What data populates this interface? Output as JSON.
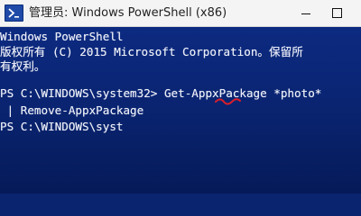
{
  "window": {
    "title": "管理员: Windows PowerShell (x86)"
  },
  "console": {
    "lines": [
      "Windows PowerShell",
      "版权所有 (C) 2015 Microsoft Corporation。保留所",
      "有权利。",
      "PS C:\\WINDOWS\\system32> Get-AppxPackage *photo*",
      " | Remove-AppxPackage",
      "PS C:\\WINDOWS\\syst"
    ]
  },
  "colors": {
    "console_background": "#0a2471",
    "console_text": "#e9ecf6",
    "titlebar_background": "#f4f4f4",
    "annotation": "#d81e2a"
  },
  "icons": {
    "app": "powershell-icon",
    "minimize": "minimize-icon",
    "maximize": "maximize-icon"
  }
}
